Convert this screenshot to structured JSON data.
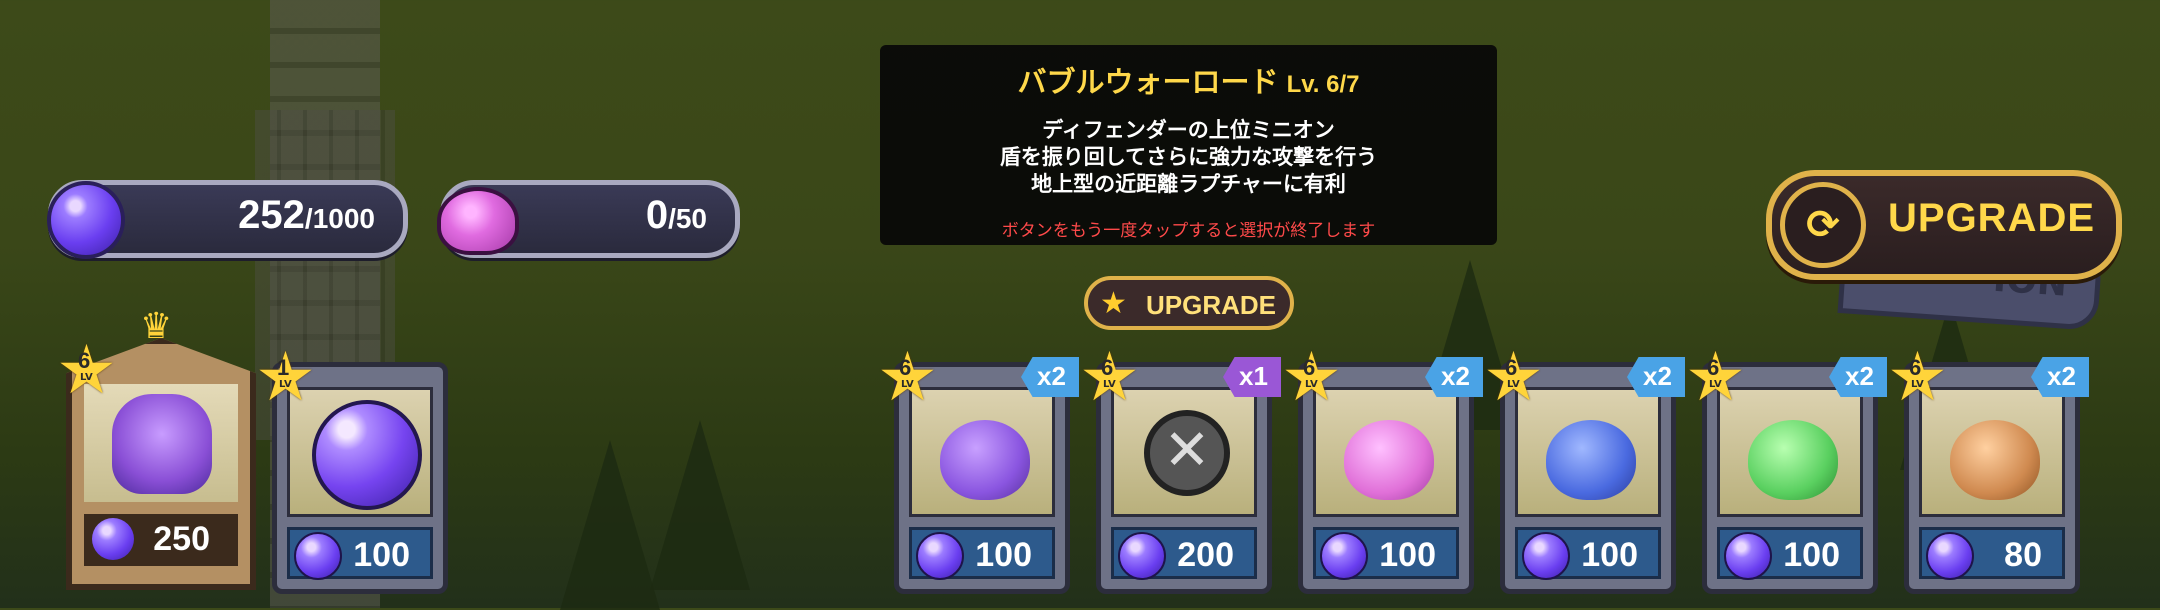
{
  "resources": {
    "orbs": {
      "value": "252",
      "max": "/1000"
    },
    "slime": {
      "value": "0",
      "max": "/50"
    }
  },
  "tooltip": {
    "title": "バブルウォーロード",
    "level": "Lv. 6/7",
    "lines": [
      "ディフェンダーの上位ミニオン",
      "盾を振り回してさらに強力な攻撃を行う",
      "地上型の近距離ラプチャーに有利"
    ],
    "note": "ボタンをもう一度タップすると選択が終了します"
  },
  "buttons": {
    "upgrade_main": "UPGRADE",
    "upgrade_small": "UPGRADE"
  },
  "hero": {
    "level": "6",
    "lv": "LV",
    "price": "250"
  },
  "orb_card": {
    "level": "1",
    "lv": "LV",
    "price": "100"
  },
  "minions": [
    {
      "level": "6",
      "lv": "LV",
      "count": "x2",
      "price": "100",
      "icon": "purple-shield-slime"
    },
    {
      "level": "6",
      "lv": "LV",
      "count": "x1",
      "price": "200",
      "icon": "cancel-selection"
    },
    {
      "level": "6",
      "lv": "LV",
      "count": "x2",
      "price": "100",
      "icon": "pink-snail-club"
    },
    {
      "level": "6",
      "lv": "LV",
      "count": "x2",
      "price": "100",
      "icon": "blue-helmet-gunner"
    },
    {
      "level": "6",
      "lv": "LV",
      "count": "x2",
      "price": "100",
      "icon": "green-slime-hammer"
    },
    {
      "level": "6",
      "lv": "LV",
      "count": "x2",
      "price": "80",
      "icon": "brown-nurse-slime"
    }
  ],
  "colors": {
    "accent": "#ffd84a",
    "price_bg": "#2d5a8c",
    "note": "#ff4a4a"
  }
}
